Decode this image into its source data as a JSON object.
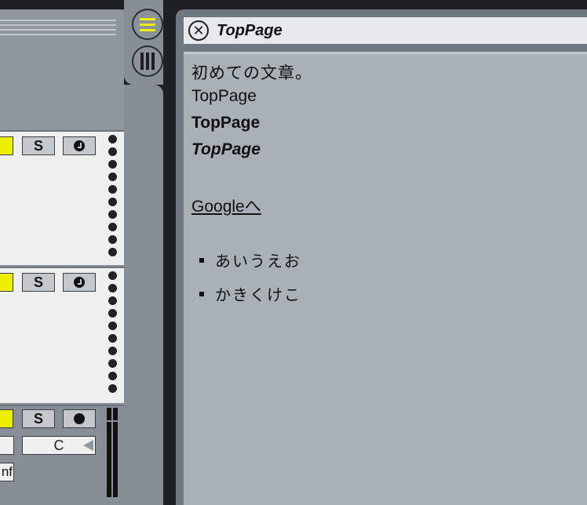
{
  "browser": {
    "title": "TopPage",
    "close_symbol": "✕",
    "content": {
      "line1": "初めての文章。",
      "line2": "TopPage",
      "line3": "TopPage",
      "line4": "TopPage",
      "link": "Googleへ",
      "list": [
        "あいうえお",
        "かきくけこ"
      ]
    }
  },
  "tracks": [
    {
      "solo_label": "S",
      "record_icon": "clock-record-icon"
    },
    {
      "solo_label": "S",
      "record_icon": "clock-record-icon"
    },
    {
      "solo_label": "S",
      "record_icon": "record-dot-icon",
      "pan_value": "C",
      "volume_text": "nf"
    }
  ],
  "side_buttons": [
    "menu-icon",
    "columns-icon"
  ],
  "colors": {
    "accent": "#ecf000",
    "panel": "#878e96",
    "content_bg": "#a9b0b6"
  }
}
